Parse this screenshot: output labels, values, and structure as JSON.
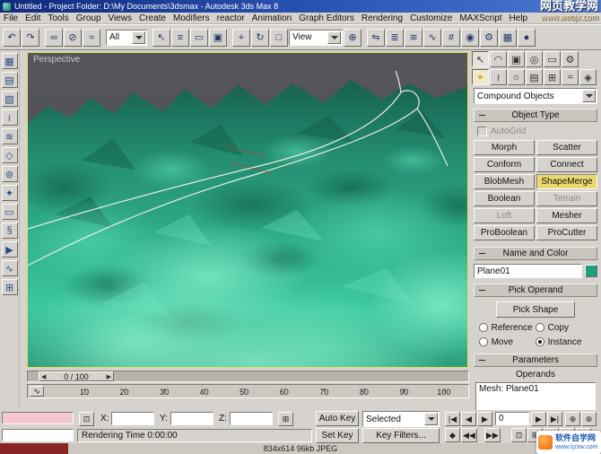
{
  "window": {
    "title": "Untitled - Project Folder: D:\\My Documents\\3dsmax - Autodesk 3ds Max 8"
  },
  "watermark_top": {
    "line1": "网页教学网",
    "line2": "www.webjx.com"
  },
  "watermark_bottom": {
    "site": "软件自学网",
    "url": "www.rjzxw.com"
  },
  "menu": {
    "items": [
      "File",
      "Edit",
      "Tools",
      "Group",
      "Views",
      "Create",
      "Modifiers",
      "reactor",
      "Animation",
      "Graph Editors",
      "Rendering",
      "Customize",
      "MAXScript",
      "Help"
    ]
  },
  "toolbar": {
    "selection_filter": "All",
    "ref_coord": "View",
    "icons_left": [
      {
        "name": "undo-icon",
        "glyph": "↶"
      },
      {
        "name": "redo-icon",
        "glyph": "↷"
      },
      {
        "name": "select-link-icon",
        "glyph": "∞"
      },
      {
        "name": "unlink-icon",
        "glyph": "⊘"
      },
      {
        "name": "bind-spacewarp-icon",
        "glyph": "≈"
      }
    ],
    "icons_mid": [
      {
        "name": "select-object-icon",
        "glyph": "↖"
      },
      {
        "name": "select-by-name-icon",
        "glyph": "≡"
      },
      {
        "name": "rect-selection-icon",
        "glyph": "▭"
      },
      {
        "name": "crossing-selection-icon",
        "glyph": "▣"
      },
      {
        "name": "select-move-icon",
        "glyph": "+"
      },
      {
        "name": "select-rotate-icon",
        "glyph": "↻"
      },
      {
        "name": "select-scale-icon",
        "glyph": "□"
      },
      {
        "name": "use-pivot-icon",
        "glyph": "⊕"
      }
    ],
    "icons_right": [
      {
        "name": "mirror-icon",
        "glyph": "⇋"
      },
      {
        "name": "align-icon",
        "glyph": "≣"
      },
      {
        "name": "layer-manager-icon",
        "glyph": "≋"
      },
      {
        "name": "curve-editor-icon",
        "glyph": "∿"
      },
      {
        "name": "schematic-view-icon",
        "glyph": "#"
      },
      {
        "name": "material-editor-icon",
        "glyph": "◉"
      },
      {
        "name": "render-scene-icon",
        "glyph": "⚙"
      },
      {
        "name": "render-type-icon",
        "glyph": "▦"
      },
      {
        "name": "quick-render-icon",
        "glyph": "●"
      }
    ]
  },
  "left_toolbar": {
    "icons": [
      {
        "name": "rigid-body-icon",
        "glyph": "▦"
      },
      {
        "name": "cloth-icon",
        "glyph": "▤"
      },
      {
        "name": "soft-body-icon",
        "glyph": "▧"
      },
      {
        "name": "rope-icon",
        "glyph": "≀"
      },
      {
        "name": "water-icon",
        "glyph": "≋"
      },
      {
        "name": "constraint-icon",
        "glyph": "◇"
      },
      {
        "name": "motor-icon",
        "glyph": "⊚"
      },
      {
        "name": "fracture-icon",
        "glyph": "✦"
      },
      {
        "name": "plane-icon",
        "glyph": "▭"
      },
      {
        "name": "spring-icon",
        "glyph": "§"
      },
      {
        "name": "preview-icon",
        "glyph": "▶"
      },
      {
        "name": "wind-icon",
        "glyph": "∿"
      },
      {
        "name": "analyze-icon",
        "glyph": "⊞"
      }
    ]
  },
  "viewport": {
    "label": "Perspective"
  },
  "panel": {
    "tabs": [
      {
        "name": "create-tab-icon",
        "glyph": "↖"
      },
      {
        "name": "modify-tab-icon",
        "glyph": "◠"
      },
      {
        "name": "hierarchy-tab-icon",
        "glyph": "▣"
      },
      {
        "name": "motion-tab-icon",
        "glyph": "◎"
      },
      {
        "name": "display-tab-icon",
        "glyph": "▭"
      },
      {
        "name": "utilities-tab-icon",
        "glyph": "⚙"
      }
    ],
    "categories": [
      {
        "name": "geometry-icon",
        "glyph": "●"
      },
      {
        "name": "shapes-icon",
        "glyph": "≀"
      },
      {
        "name": "lights-icon",
        "glyph": "☼"
      },
      {
        "name": "cameras-icon",
        "glyph": "▤"
      },
      {
        "name": "helpers-icon",
        "glyph": "⊞"
      },
      {
        "name": "space-warps-icon",
        "glyph": "≈"
      },
      {
        "name": "systems-icon",
        "glyph": "◈"
      }
    ],
    "category_dropdown": "Compound Objects",
    "rollout_object_type": "Object Type",
    "autogrid_label": "AutoGrid",
    "object_type_buttons": [
      "Morph",
      "Scatter",
      "Conform",
      "Connect",
      "BlobMesh",
      "ShapeMerge",
      "Boolean",
      "Terrain",
      "Loft",
      "Mesher",
      "ProBoolean",
      "ProCutter"
    ],
    "selected_button": "ShapeMerge",
    "disabled_buttons": [
      "Terrain",
      "Loft"
    ],
    "rollout_name_color": "Name and Color",
    "object_name": "Plane01",
    "object_color": "#1f9e7e",
    "rollout_pick_operand": "Pick Operand",
    "pick_shape_label": "Pick Shape",
    "clone_options": [
      "Reference",
      "Copy",
      "Move",
      "Instance"
    ],
    "clone_selected": "Instance",
    "rollout_parameters": "Parameters",
    "operands_label": "Operands",
    "operands": [
      "Mesh: Plane01"
    ]
  },
  "timeline": {
    "slider_label": "0 / 100",
    "ticks": [
      "10",
      "20",
      "30",
      "40",
      "50",
      "60",
      "70",
      "80",
      "90",
      "100"
    ],
    "icons": [
      {
        "name": "mini-curve-editor-icon",
        "glyph": "∿"
      },
      {
        "name": "frame-back-icon",
        "glyph": "◀"
      },
      {
        "name": "frame-forward-icon",
        "glyph": "▶"
      }
    ]
  },
  "status": {
    "x_label": "X:",
    "y_label": "Y:",
    "z_label": "Z:",
    "x_value": "",
    "y_value": "",
    "z_value": "",
    "auto_key": "Auto Key",
    "set_key": "Set Key",
    "selected_filter": "Selected",
    "key_filters": "Key Filters...",
    "prompt": "Rendering Time  0:00:00",
    "frame_value": "0",
    "icons": [
      {
        "name": "selection-lock-icon",
        "glyph": "⊡"
      },
      {
        "name": "grid-snap-icon",
        "glyph": "⊞"
      }
    ],
    "playback": [
      {
        "name": "go-to-start-icon",
        "glyph": "|◀"
      },
      {
        "name": "previous-frame-icon",
        "glyph": "◀"
      },
      {
        "name": "play-icon",
        "glyph": "▶"
      },
      {
        "name": "next-frame-icon",
        "glyph": "▶"
      },
      {
        "name": "go-to-end-icon",
        "glyph": "▶|"
      }
    ],
    "keys": [
      {
        "name": "key-mode-icon",
        "glyph": "◆"
      },
      {
        "name": "previous-key-icon",
        "glyph": "◀◀"
      },
      {
        "name": "next-key-icon",
        "glyph": "▶▶"
      }
    ],
    "nav": [
      {
        "name": "zoom-icon",
        "glyph": "⊕"
      },
      {
        "name": "zoom-all-icon",
        "glyph": "⊛"
      },
      {
        "name": "zoom-extents-icon",
        "glyph": "⊡"
      },
      {
        "name": "zoom-extents-all-icon",
        "glyph": "⊞"
      },
      {
        "name": "zoom-region-icon",
        "glyph": "▭"
      },
      {
        "name": "pan-icon",
        "glyph": "+"
      },
      {
        "name": "arc-rotate-icon",
        "glyph": "↻"
      },
      {
        "name": "maximize-viewport-icon",
        "glyph": "◰"
      }
    ]
  },
  "footer": {
    "info": "834x614  96kb  JPEG"
  }
}
